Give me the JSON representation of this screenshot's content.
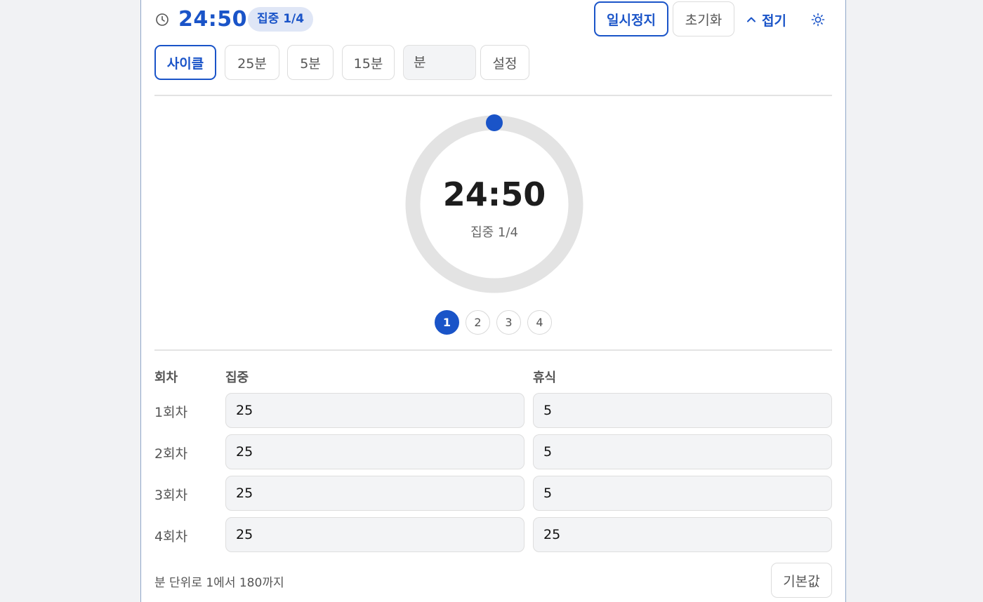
{
  "header": {
    "time": "24:50",
    "phase_badge": "집중 1/4",
    "pause_label": "일시정지",
    "reset_label": "초기화",
    "collapse_label": "접기"
  },
  "presets": {
    "cycle_label": "사이클",
    "p25_label": "25분",
    "p5_label": "5분",
    "p15_label": "15분",
    "minutes_placeholder": "분",
    "setting_label": "설정"
  },
  "dial": {
    "time": "24:50",
    "label": "집중 1/4",
    "progress_fraction": 0.0,
    "accent": "#1a54c8",
    "track": "#e3e3e3"
  },
  "steps": [
    "1",
    "2",
    "3",
    "4"
  ],
  "active_step": 1,
  "table": {
    "col_round": "회차",
    "col_focus": "집중",
    "col_rest": "휴식",
    "rows": [
      {
        "label": "1회차",
        "focus": "25",
        "rest": "5"
      },
      {
        "label": "2회차",
        "focus": "25",
        "rest": "5"
      },
      {
        "label": "3회차",
        "focus": "25",
        "rest": "5"
      },
      {
        "label": "4회차",
        "focus": "25",
        "rest": "25"
      }
    ]
  },
  "footer": {
    "hint": "분 단위로 1에서 180까지",
    "default_label": "기본값"
  },
  "icons": {
    "clock": "clock-icon",
    "chevron": "chevron-up-icon",
    "theme": "sun-icon"
  }
}
